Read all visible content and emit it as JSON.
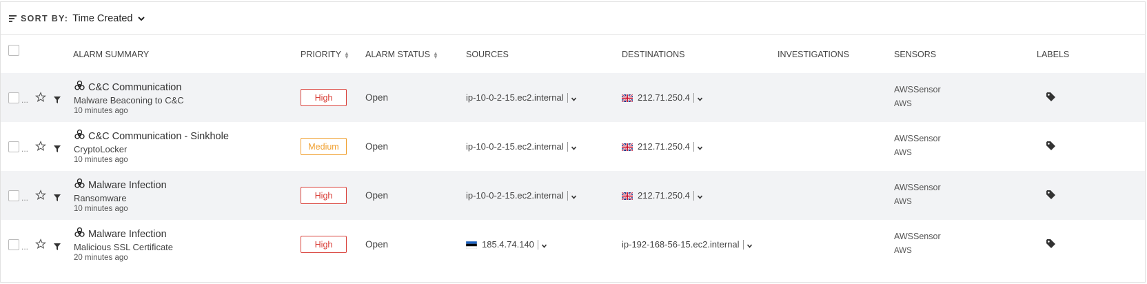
{
  "sort": {
    "label": "SORT BY:",
    "value": "Time Created"
  },
  "columns": {
    "summary": "ALARM SUMMARY",
    "priority": "PRIORITY",
    "status": "ALARM STATUS",
    "sources": "SOURCES",
    "destinations": "DESTINATIONS",
    "investigations": "INVESTIGATIONS",
    "sensors": "SENSORS",
    "labels": "LABELS"
  },
  "colors": {
    "high": "#d9413a",
    "medium": "#f0a030"
  },
  "alarms": [
    {
      "title": "C&C Communication",
      "subtitle": "Malware Beaconing to C&C",
      "time": "10 minutes ago",
      "priority": "High",
      "status": "Open",
      "source": "ip-10-0-2-15.ec2.internal",
      "destination": "212.71.250.4",
      "sensor": "AWSSensor",
      "sensor_type": "AWS"
    },
    {
      "title": "C&C Communication - Sinkhole",
      "subtitle": "CryptoLocker",
      "time": "10 minutes ago",
      "priority": "Medium",
      "status": "Open",
      "source": "ip-10-0-2-15.ec2.internal",
      "destination": "212.71.250.4",
      "sensor": "AWSSensor",
      "sensor_type": "AWS"
    },
    {
      "title": "Malware Infection",
      "subtitle": "Ransomware",
      "time": "10 minutes ago",
      "priority": "High",
      "status": "Open",
      "source": "ip-10-0-2-15.ec2.internal",
      "destination": "212.71.250.4",
      "sensor": "AWSSensor",
      "sensor_type": "AWS"
    },
    {
      "title": "Malware Infection",
      "subtitle": "Malicious SSL Certificate",
      "time": "20 minutes ago",
      "priority": "High",
      "status": "Open",
      "source": "185.4.74.140",
      "destination": "ip-192-168-56-15.ec2.internal",
      "sensor": "AWSSensor",
      "sensor_type": "AWS"
    }
  ]
}
